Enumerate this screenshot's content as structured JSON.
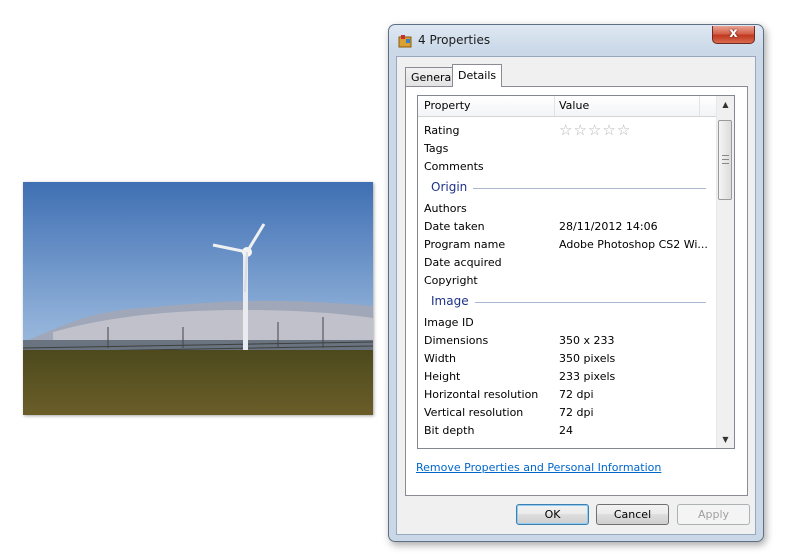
{
  "window": {
    "title": "4 Properties",
    "close_label": "x"
  },
  "tabs": [
    {
      "label": "General"
    },
    {
      "label": "Details"
    }
  ],
  "list": {
    "header": {
      "property": "Property",
      "value": "Value"
    },
    "top_rows": [
      {
        "property": "Rating",
        "value": ""
      },
      {
        "property": "Tags",
        "value": ""
      },
      {
        "property": "Comments",
        "value": ""
      }
    ],
    "groups": [
      {
        "title": "Origin",
        "rows": [
          {
            "property": "Authors",
            "value": ""
          },
          {
            "property": "Date taken",
            "value": "28/11/2012 14:06"
          },
          {
            "property": "Program name",
            "value": "Adobe Photoshop CS2 Wi..."
          },
          {
            "property": "Date acquired",
            "value": ""
          },
          {
            "property": "Copyright",
            "value": ""
          }
        ]
      },
      {
        "title": "Image",
        "rows": [
          {
            "property": "Image ID",
            "value": ""
          },
          {
            "property": "Dimensions",
            "value": "350 x 233"
          },
          {
            "property": "Width",
            "value": "350 pixels"
          },
          {
            "property": "Height",
            "value": "233 pixels"
          },
          {
            "property": "Horizontal resolution",
            "value": "72 dpi"
          },
          {
            "property": "Vertical resolution",
            "value": "72 dpi"
          },
          {
            "property": "Bit depth",
            "value": "24"
          }
        ]
      }
    ],
    "rating_stars": 0,
    "rating_max": 5
  },
  "remove_link": "Remove Properties and Personal Information",
  "buttons": {
    "ok": "OK",
    "cancel": "Cancel",
    "apply": "Apply"
  },
  "colors": {
    "group_title": "#1e3287",
    "link": "#0066cc",
    "close_button": "#c0391f"
  }
}
